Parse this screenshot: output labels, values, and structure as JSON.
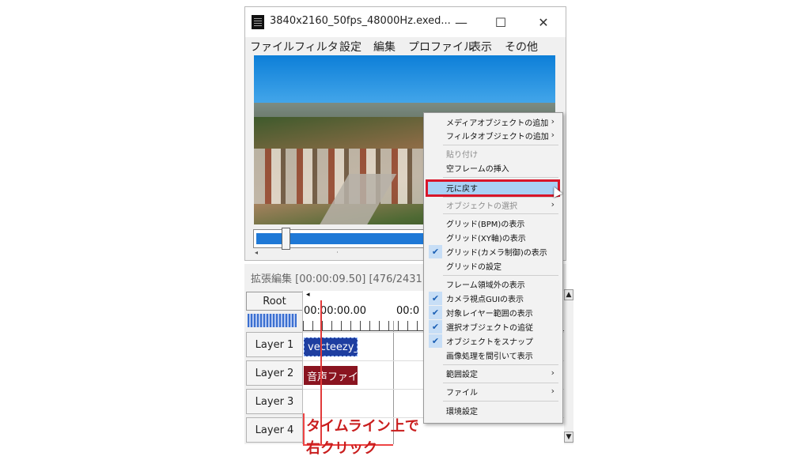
{
  "window": {
    "title": "3840x2160_50fps_48000Hz.exed...",
    "controls": {
      "minimize": "—",
      "maximize": "☐",
      "close": "✕"
    },
    "menu": [
      "ファイル",
      "フィルタ",
      "設定",
      "編集",
      "プロファイル",
      "表示",
      "その他"
    ]
  },
  "playback": {
    "position_fraction": 0.13
  },
  "timeline": {
    "header": "拡張編集 [00:00:09.50] [476/2431]",
    "root_label": "Root",
    "time_marks": [
      "00:00:00.00",
      "00:0"
    ],
    "layers": [
      "Layer 1",
      "Layer 2",
      "Layer 3",
      "Layer 4"
    ],
    "clips": {
      "video": "vecteezy_a",
      "audio": "音声ファイル"
    },
    "annotation": "タイムライン上で\n右クリック",
    "scroll_up": "▲",
    "scroll_down": "▼"
  },
  "context_menu": {
    "items": [
      {
        "label": "メディアオブジェクトの追加",
        "submenu": true
      },
      {
        "label": "フィルタオブジェクトの追加",
        "submenu": true
      },
      {
        "label": "貼り付け",
        "disabled": true
      },
      {
        "label": "空フレームの挿入"
      },
      {
        "label": "元に戻す",
        "highlighted": true
      },
      {
        "label": "オブジェクトの選択",
        "disabled": true,
        "submenu": true
      },
      {
        "label": "グリッド(BPM)の表示"
      },
      {
        "label": "グリッド(XY軸)の表示"
      },
      {
        "label": "グリッド(カメラ制御)の表示",
        "checked": true
      },
      {
        "label": "グリッドの設定"
      },
      {
        "label": "フレーム領域外の表示"
      },
      {
        "label": "カメラ視点GUIの表示",
        "checked": true
      },
      {
        "label": "対象レイヤー範囲の表示",
        "checked": true
      },
      {
        "label": "選択オブジェクトの追従",
        "checked": true
      },
      {
        "label": "オブジェクトをスナップ",
        "checked": true
      },
      {
        "label": "画像処理を間引いて表示"
      },
      {
        "label": "範囲設定",
        "submenu": true
      },
      {
        "label": "ファイル",
        "submenu": true
      },
      {
        "label": "環境設定"
      }
    ],
    "submenu_arrow": "›",
    "check_mark": "✔"
  }
}
